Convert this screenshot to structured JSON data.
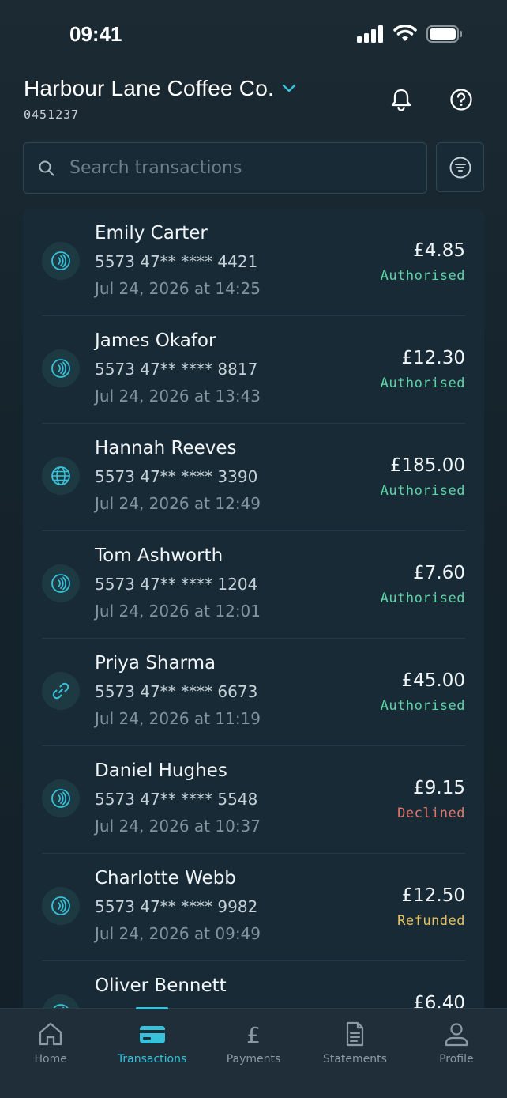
{
  "status_bar": {
    "time": "09:41"
  },
  "header": {
    "merchant_name": "Harbour Lane Coffee Co.",
    "merchant_id": "0451237"
  },
  "search": {
    "placeholder": "Search transactions",
    "value": ""
  },
  "colors": {
    "accent": "#37c1da",
    "authorised": "#5fd4a6",
    "declined": "#e4766b",
    "refunded": "#e8c25e"
  },
  "transactions": [
    {
      "name": "Emily Carter",
      "card": "5573 47** **** 4421",
      "date": "Jul 24, 2026 at 14:25",
      "amount": "£4.85",
      "status": "Authorised",
      "method_icon": "contactless-icon"
    },
    {
      "name": "James Okafor",
      "card": "5573 47** **** 8817",
      "date": "Jul 24, 2026 at 13:43",
      "amount": "£12.30",
      "status": "Authorised",
      "method_icon": "contactless-icon"
    },
    {
      "name": "Hannah Reeves",
      "card": "5573 47** **** 3390",
      "date": "Jul 24, 2026 at 12:49",
      "amount": "£185.00",
      "status": "Authorised",
      "method_icon": "globe-icon"
    },
    {
      "name": "Tom Ashworth",
      "card": "5573 47** **** 1204",
      "date": "Jul 24, 2026 at 12:01",
      "amount": "£7.60",
      "status": "Authorised",
      "method_icon": "contactless-icon"
    },
    {
      "name": "Priya Sharma",
      "card": "5573 47** **** 6673",
      "date": "Jul 24, 2026 at 11:19",
      "amount": "£45.00",
      "status": "Authorised",
      "method_icon": "link-icon"
    },
    {
      "name": "Daniel Hughes",
      "card": "5573 47** **** 5548",
      "date": "Jul 24, 2026 at 10:37",
      "amount": "£9.15",
      "status": "Declined",
      "method_icon": "contactless-icon"
    },
    {
      "name": "Charlotte Webb",
      "card": "5573 47** **** 9982",
      "date": "Jul 24, 2026 at 09:49",
      "amount": "£12.50",
      "status": "Refunded",
      "method_icon": "contactless-icon"
    },
    {
      "name": "Oliver Bennett",
      "card": "",
      "date": "",
      "amount": "£6.40",
      "status": "",
      "method_icon": "contactless-icon"
    }
  ],
  "nav": {
    "items": [
      {
        "label": "Home",
        "icon": "home-icon"
      },
      {
        "label": "Transactions",
        "icon": "card-icon",
        "active": true
      },
      {
        "label": "Payments",
        "icon": "pound-icon"
      },
      {
        "label": "Statements",
        "icon": "document-icon"
      },
      {
        "label": "Profile",
        "icon": "profile-icon"
      }
    ]
  }
}
